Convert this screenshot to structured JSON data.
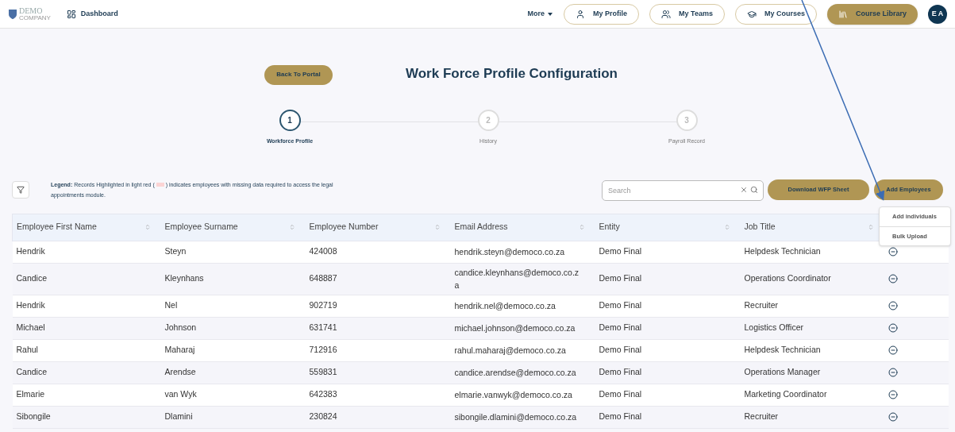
{
  "nav": {
    "logo": {
      "word": "DEMO",
      "sub": "COMPANY"
    },
    "dashboard": "Dashboard",
    "more": "More",
    "links": [
      {
        "label": "My Profile",
        "kind": "profile",
        "selected": false
      },
      {
        "label": "My Teams",
        "kind": "teams",
        "selected": false
      },
      {
        "label": "My Courses",
        "kind": "courses",
        "selected": false
      },
      {
        "label": "Course Library",
        "kind": "library",
        "selected": true
      }
    ],
    "avatar": "E A"
  },
  "back_button": "Back To Portal",
  "title": "Work Force Profile Configuration",
  "steps": [
    {
      "number": "1",
      "label": "Workforce Profile",
      "selected": true
    },
    {
      "number": "2",
      "label": "History",
      "selected": false
    },
    {
      "number": "3",
      "label": "Payroll Record",
      "selected": false
    }
  ],
  "legend": "**Legend:** Records Highlighted in light red ( ",
  "legend_rest": " ) indicates employees with missing data required to access the legal appointments module.",
  "search": {
    "placeholder": "Search"
  },
  "download_button": "Download WFP Sheet",
  "add_button": "Add Employees",
  "add_menu": {
    "expanded": true,
    "items": [
      "Add individuals",
      "Bulk Upload"
    ]
  },
  "table": {
    "columns": [
      "Employee First Name",
      "Employee Surname",
      "Employee Number",
      "Email Address",
      "Entity",
      "Job Title"
    ],
    "rows": [
      [
        "Hendrik",
        "Steyn",
        "424008",
        "hendrik.steyn@democo.co.za",
        "Demo Final",
        "Helpdesk Technician"
      ],
      [
        "Candice",
        "Kleynhans",
        "648887",
        "candice.kleynhans@democo.co.za",
        "Demo Final",
        "Operations Coordinator"
      ],
      [
        "Hendrik",
        "Nel",
        "902719",
        "hendrik.nel@democo.co.za",
        "Demo Final",
        "Recruiter"
      ],
      [
        "Michael",
        "Johnson",
        "631741",
        "michael.johnson@democo.co.za",
        "Demo Final",
        "Logistics Officer"
      ],
      [
        "Rahul",
        "Maharaj",
        "712916",
        "rahul.maharaj@democo.co.za",
        "Demo Final",
        "Helpdesk Technician"
      ],
      [
        "Candice",
        "Arendse",
        "559831",
        "candice.arendse@democo.co.za",
        "Demo Final",
        "Operations Manager"
      ],
      [
        "Elmarie",
        "van Wyk",
        "642383",
        "elmarie.vanwyk@democo.co.za",
        "Demo Final",
        "Marketing Coordinator"
      ],
      [
        "Sibongile",
        "Dlamini",
        "230824",
        "sibongile.dlamini@democo.co.za",
        "Demo Final",
        "Recruiter"
      ]
    ]
  }
}
